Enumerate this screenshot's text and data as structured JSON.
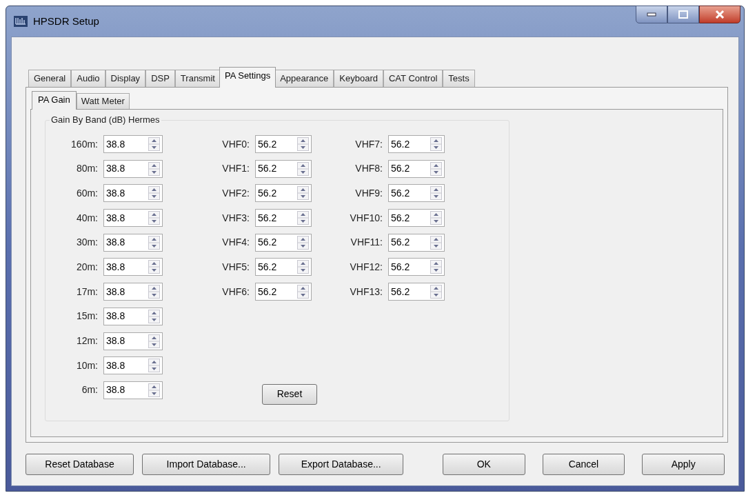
{
  "window": {
    "title": "HPSDR Setup"
  },
  "tabs": [
    {
      "label": "General",
      "selected": false
    },
    {
      "label": "Audio",
      "selected": false
    },
    {
      "label": "Display",
      "selected": false
    },
    {
      "label": "DSP",
      "selected": false
    },
    {
      "label": "Transmit",
      "selected": false
    },
    {
      "label": "PA Settings",
      "selected": true
    },
    {
      "label": "Appearance",
      "selected": false
    },
    {
      "label": "Keyboard",
      "selected": false
    },
    {
      "label": "CAT Control",
      "selected": false
    },
    {
      "label": "Tests",
      "selected": false
    }
  ],
  "subtabs": [
    {
      "label": "PA Gain",
      "selected": true
    },
    {
      "label": "Watt Meter",
      "selected": false
    }
  ],
  "group": {
    "title": "Gain By Band (dB) Hermes",
    "columns": [
      [
        {
          "label": "160m:",
          "value": "38.8"
        },
        {
          "label": "80m:",
          "value": "38.8"
        },
        {
          "label": "60m:",
          "value": "38.8"
        },
        {
          "label": "40m:",
          "value": "38.8"
        },
        {
          "label": "30m:",
          "value": "38.8"
        },
        {
          "label": "20m:",
          "value": "38.8"
        },
        {
          "label": "17m:",
          "value": "38.8"
        },
        {
          "label": "15m:",
          "value": "38.8"
        },
        {
          "label": "12m:",
          "value": "38.8"
        },
        {
          "label": "10m:",
          "value": "38.8"
        },
        {
          "label": "6m:",
          "value": "38.8"
        }
      ],
      [
        {
          "label": "VHF0:",
          "value": "56.2"
        },
        {
          "label": "VHF1:",
          "value": "56.2"
        },
        {
          "label": "VHF2:",
          "value": "56.2"
        },
        {
          "label": "VHF3:",
          "value": "56.2"
        },
        {
          "label": "VHF4:",
          "value": "56.2"
        },
        {
          "label": "VHF5:",
          "value": "56.2"
        },
        {
          "label": "VHF6:",
          "value": "56.2"
        }
      ],
      [
        {
          "label": "VHF7:",
          "value": "56.2"
        },
        {
          "label": "VHF8:",
          "value": "56.2"
        },
        {
          "label": "VHF9:",
          "value": "56.2"
        },
        {
          "label": "VHF10:",
          "value": "56.2"
        },
        {
          "label": "VHF11:",
          "value": "56.2"
        },
        {
          "label": "VHF12:",
          "value": "56.2"
        },
        {
          "label": "VHF13:",
          "value": "56.2"
        }
      ]
    ],
    "reset_button": "Reset"
  },
  "buttons_left": [
    "Reset Database",
    "Import Database...",
    "Export Database..."
  ],
  "buttons_right": [
    "OK",
    "Cancel",
    "Apply"
  ]
}
